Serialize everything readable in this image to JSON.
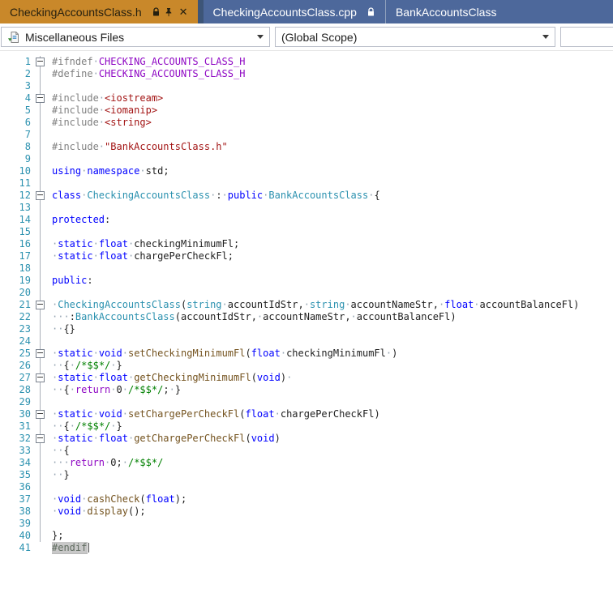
{
  "tabs": [
    {
      "label": "CheckingAccountsClass.h",
      "state": "active",
      "icons": [
        "lock-icon",
        "pin-icon",
        "close-icon"
      ]
    },
    {
      "label": "CheckingAccountsClass.cpp",
      "state": "inactive",
      "icons": [
        "lock-icon"
      ]
    },
    {
      "label": "BankAccountsClass",
      "state": "inactive",
      "icons": []
    }
  ],
  "tab_close_glyph": "✕",
  "navbar": {
    "project_selector": "Miscellaneous Files",
    "scope_selector": "(Global Scope)",
    "member_selector": ""
  },
  "colors": {
    "active_tab_bg": "#C9882A",
    "inactive_tab_bg": "#4D689B",
    "line_number": "#2B91AF",
    "keyword": "#0000FF",
    "type_name": "#2B91AF",
    "string_literal": "#A31515",
    "comment": "#008000",
    "preprocessor": "#808080",
    "macro": "#8F08C4",
    "control_keyword": "#8F08C4",
    "function_name": "#74531F",
    "whitespace_dot": "#94A3B1",
    "endif_highlight_bg": "#C8C8C8"
  },
  "editor": {
    "lines": [
      {
        "n": 1,
        "out": "box",
        "seg": [
          [
            "#ifndef",
            "pp"
          ],
          [
            "·",
            "ws"
          ],
          [
            "CHECKING_ACCOUNTS_CLASS_H",
            "mac"
          ]
        ]
      },
      {
        "n": 2,
        "out": "line",
        "seg": [
          [
            "#define",
            "pp"
          ],
          [
            "·",
            "ws"
          ],
          [
            "CHECKING_ACCOUNTS_CLASS_H",
            "mac"
          ]
        ]
      },
      {
        "n": 3,
        "out": "line",
        "seg": []
      },
      {
        "n": 4,
        "out": "box",
        "seg": [
          [
            "#include",
            "pp"
          ],
          [
            "·",
            "ws"
          ],
          [
            "<iostream>",
            "str"
          ]
        ]
      },
      {
        "n": 5,
        "out": "line",
        "seg": [
          [
            "#include",
            "pp"
          ],
          [
            "·",
            "ws"
          ],
          [
            "<iomanip>",
            "str"
          ]
        ]
      },
      {
        "n": 6,
        "out": "line",
        "seg": [
          [
            "#include",
            "pp"
          ],
          [
            "·",
            "ws"
          ],
          [
            "<string>",
            "str"
          ]
        ]
      },
      {
        "n": 7,
        "out": "line",
        "seg": []
      },
      {
        "n": 8,
        "out": "line",
        "seg": [
          [
            "#include",
            "pp"
          ],
          [
            "·",
            "ws"
          ],
          [
            "\"BankAccountsClass.h\"",
            "str"
          ]
        ]
      },
      {
        "n": 9,
        "out": "line",
        "seg": []
      },
      {
        "n": 10,
        "out": "line",
        "seg": [
          [
            "using",
            "kw"
          ],
          [
            "·",
            "ws"
          ],
          [
            "namespace",
            "kw"
          ],
          [
            "·",
            "ws"
          ],
          [
            "std",
            "id"
          ],
          [
            ";",
            "id"
          ]
        ]
      },
      {
        "n": 11,
        "out": "line",
        "seg": []
      },
      {
        "n": 12,
        "out": "box",
        "seg": [
          [
            "class",
            "kw"
          ],
          [
            "·",
            "ws"
          ],
          [
            "CheckingAccountsClass",
            "type"
          ],
          [
            "·",
            "ws"
          ],
          [
            ":",
            "id"
          ],
          [
            "·",
            "ws"
          ],
          [
            "public",
            "kw"
          ],
          [
            "·",
            "ws"
          ],
          [
            "BankAccountsClass",
            "type"
          ],
          [
            "·",
            "ws"
          ],
          [
            "{",
            "id"
          ]
        ]
      },
      {
        "n": 13,
        "out": "line",
        "seg": []
      },
      {
        "n": 14,
        "out": "line",
        "seg": [
          [
            "protected",
            "kw"
          ],
          [
            ":",
            "id"
          ]
        ]
      },
      {
        "n": 15,
        "out": "line",
        "seg": []
      },
      {
        "n": 16,
        "out": "line",
        "seg": [
          [
            "·",
            "ws"
          ],
          [
            "static",
            "kw"
          ],
          [
            "·",
            "ws"
          ],
          [
            "float",
            "kw"
          ],
          [
            "·",
            "ws"
          ],
          [
            "checkingMinimumFl",
            "id"
          ],
          [
            ";",
            "id"
          ]
        ]
      },
      {
        "n": 17,
        "out": "line",
        "seg": [
          [
            "·",
            "ws"
          ],
          [
            "static",
            "kw"
          ],
          [
            "·",
            "ws"
          ],
          [
            "float",
            "kw"
          ],
          [
            "·",
            "ws"
          ],
          [
            "chargePerCheckFl",
            "id"
          ],
          [
            ";",
            "id"
          ]
        ]
      },
      {
        "n": 18,
        "out": "line",
        "seg": []
      },
      {
        "n": 19,
        "out": "line",
        "seg": [
          [
            "public",
            "kw"
          ],
          [
            ":",
            "id"
          ]
        ]
      },
      {
        "n": 20,
        "out": "line",
        "seg": []
      },
      {
        "n": 21,
        "out": "box",
        "seg": [
          [
            "·",
            "ws"
          ],
          [
            "CheckingAccountsClass",
            "type"
          ],
          [
            "(",
            "id"
          ],
          [
            "string",
            "type"
          ],
          [
            "·",
            "ws"
          ],
          [
            "accountIdStr",
            "id"
          ],
          [
            ",",
            "id"
          ],
          [
            "·",
            "ws"
          ],
          [
            "string",
            "type"
          ],
          [
            "·",
            "ws"
          ],
          [
            "accountNameStr",
            "id"
          ],
          [
            ",",
            "id"
          ],
          [
            "·",
            "ws"
          ],
          [
            "float",
            "kw"
          ],
          [
            "·",
            "ws"
          ],
          [
            "accountBalanceFl",
            "id"
          ],
          [
            ")",
            "id"
          ]
        ]
      },
      {
        "n": 22,
        "out": "line",
        "seg": [
          [
            "···",
            "ws"
          ],
          [
            ":",
            "id"
          ],
          [
            "BankAccountsClass",
            "type"
          ],
          [
            "(",
            "id"
          ],
          [
            "accountIdStr",
            "id"
          ],
          [
            ",",
            "id"
          ],
          [
            "·",
            "ws"
          ],
          [
            "accountNameStr",
            "id"
          ],
          [
            ",",
            "id"
          ],
          [
            "·",
            "ws"
          ],
          [
            "accountBalanceFl",
            "id"
          ],
          [
            ")",
            "id"
          ]
        ]
      },
      {
        "n": 23,
        "out": "line",
        "seg": [
          [
            "··",
            "ws"
          ],
          [
            "{}",
            "id"
          ]
        ]
      },
      {
        "n": 24,
        "out": "line",
        "seg": []
      },
      {
        "n": 25,
        "out": "box",
        "seg": [
          [
            "·",
            "ws"
          ],
          [
            "static",
            "kw"
          ],
          [
            "·",
            "ws"
          ],
          [
            "void",
            "kw"
          ],
          [
            "·",
            "ws"
          ],
          [
            "setCheckingMinimumFl",
            "fn"
          ],
          [
            "(",
            "id"
          ],
          [
            "float",
            "kw"
          ],
          [
            "·",
            "ws"
          ],
          [
            "checkingMinimumFl",
            "id"
          ],
          [
            "·",
            "ws"
          ],
          [
            ")",
            "id"
          ]
        ]
      },
      {
        "n": 26,
        "out": "line",
        "seg": [
          [
            "··",
            "ws"
          ],
          [
            "{",
            "id"
          ],
          [
            "·",
            "ws"
          ],
          [
            "/*$$*/",
            "cm"
          ],
          [
            "·",
            "ws"
          ],
          [
            "}",
            "id"
          ]
        ]
      },
      {
        "n": 27,
        "out": "box",
        "seg": [
          [
            "·",
            "ws"
          ],
          [
            "static",
            "kw"
          ],
          [
            "·",
            "ws"
          ],
          [
            "float",
            "kw"
          ],
          [
            "·",
            "ws"
          ],
          [
            "getCheckingMinimumFl",
            "fn"
          ],
          [
            "(",
            "id"
          ],
          [
            "void",
            "kw"
          ],
          [
            ")",
            "id"
          ],
          [
            "·",
            "ws"
          ]
        ]
      },
      {
        "n": 28,
        "out": "line",
        "seg": [
          [
            "··",
            "ws"
          ],
          [
            "{",
            "id"
          ],
          [
            "·",
            "ws"
          ],
          [
            "return",
            "ctl"
          ],
          [
            "·",
            "ws"
          ],
          [
            "0",
            "id"
          ],
          [
            "·",
            "ws"
          ],
          [
            "/*$$*/",
            "cm"
          ],
          [
            ";",
            "id"
          ],
          [
            "·",
            "ws"
          ],
          [
            "}",
            "id"
          ]
        ]
      },
      {
        "n": 29,
        "out": "line",
        "seg": []
      },
      {
        "n": 30,
        "out": "box",
        "seg": [
          [
            "·",
            "ws"
          ],
          [
            "static",
            "kw"
          ],
          [
            "·",
            "ws"
          ],
          [
            "void",
            "kw"
          ],
          [
            "·",
            "ws"
          ],
          [
            "setChargePerCheckFl",
            "fn"
          ],
          [
            "(",
            "id"
          ],
          [
            "float",
            "kw"
          ],
          [
            "·",
            "ws"
          ],
          [
            "chargePerCheckFl",
            "id"
          ],
          [
            ")",
            "id"
          ]
        ]
      },
      {
        "n": 31,
        "out": "line",
        "seg": [
          [
            "··",
            "ws"
          ],
          [
            "{",
            "id"
          ],
          [
            "·",
            "ws"
          ],
          [
            "/*$$*/",
            "cm"
          ],
          [
            "·",
            "ws"
          ],
          [
            "}",
            "id"
          ]
        ]
      },
      {
        "n": 32,
        "out": "box",
        "seg": [
          [
            "·",
            "ws"
          ],
          [
            "static",
            "kw"
          ],
          [
            "·",
            "ws"
          ],
          [
            "float",
            "kw"
          ],
          [
            "·",
            "ws"
          ],
          [
            "getChargePerCheckFl",
            "fn"
          ],
          [
            "(",
            "id"
          ],
          [
            "void",
            "kw"
          ],
          [
            ")",
            "id"
          ]
        ]
      },
      {
        "n": 33,
        "out": "line",
        "seg": [
          [
            "··",
            "ws"
          ],
          [
            "{",
            "id"
          ]
        ]
      },
      {
        "n": 34,
        "out": "line",
        "seg": [
          [
            "···",
            "ws"
          ],
          [
            "return",
            "ctl"
          ],
          [
            "·",
            "ws"
          ],
          [
            "0",
            "id"
          ],
          [
            ";",
            "id"
          ],
          [
            "·",
            "ws"
          ],
          [
            "/*$$*/",
            "cm"
          ]
        ]
      },
      {
        "n": 35,
        "out": "line",
        "seg": [
          [
            "··",
            "ws"
          ],
          [
            "}",
            "id"
          ]
        ]
      },
      {
        "n": 36,
        "out": "line",
        "seg": []
      },
      {
        "n": 37,
        "out": "line",
        "seg": [
          [
            "·",
            "ws"
          ],
          [
            "void",
            "kw"
          ],
          [
            "·",
            "ws"
          ],
          [
            "cashCheck",
            "fn"
          ],
          [
            "(",
            "id"
          ],
          [
            "float",
            "kw"
          ],
          [
            ")",
            "id"
          ],
          [
            ";",
            "id"
          ]
        ]
      },
      {
        "n": 38,
        "out": "line",
        "seg": [
          [
            "·",
            "ws"
          ],
          [
            "void",
            "kw"
          ],
          [
            "·",
            "ws"
          ],
          [
            "display",
            "fn"
          ],
          [
            "(",
            "id"
          ],
          [
            ")",
            "id"
          ],
          [
            ";",
            "id"
          ]
        ]
      },
      {
        "n": 39,
        "out": "line",
        "seg": []
      },
      {
        "n": 40,
        "out": "line",
        "seg": [
          [
            "}",
            "id"
          ],
          [
            ";",
            "id"
          ]
        ]
      },
      {
        "n": 41,
        "out": "none",
        "seg": [
          [
            "#endif",
            "ppHl"
          ],
          [
            "",
            "caret"
          ]
        ]
      }
    ]
  }
}
